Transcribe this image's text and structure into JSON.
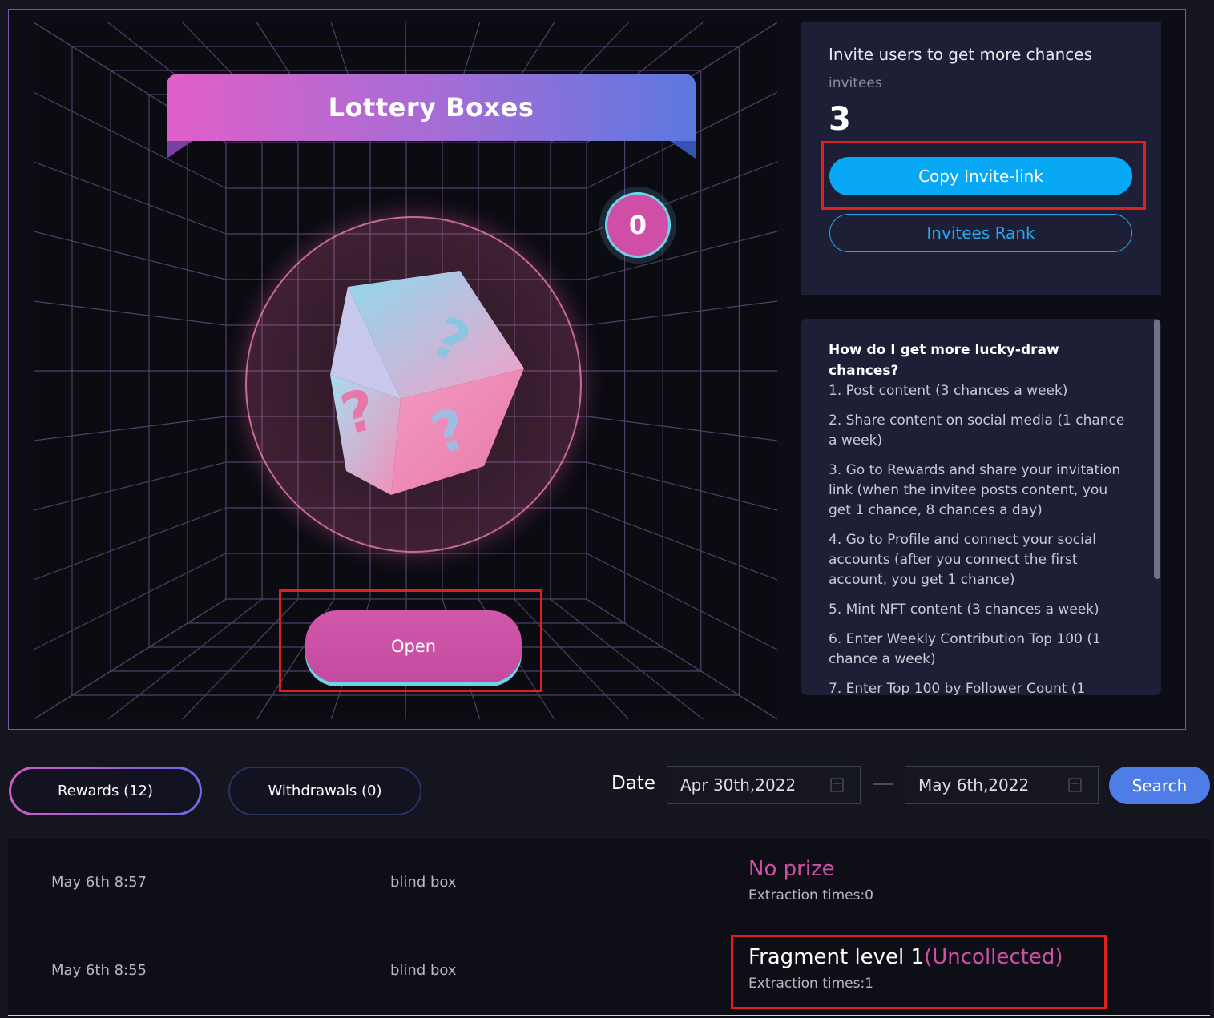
{
  "lottery": {
    "title": "Lottery Boxes",
    "box_count": "0",
    "open_label": "Open"
  },
  "invite": {
    "title": "Invite users to get more chances",
    "invitees_label": "invitees",
    "invitees_count": "3",
    "copy_button": "Copy Invite-link",
    "rank_button": "Invitees Rank"
  },
  "rules": {
    "title": "How do I get more lucky-draw chances?",
    "items": [
      "1. Post content (3 chances a week)",
      "2. Share content on social media (1 chance a week)",
      "3. Go to Rewards and share your invitation link (when the invitee posts content, you get 1 chance, 8 chances a day)",
      "4. Go to Profile and connect your social accounts (after you connect the first account, you get 1 chance)",
      "5. Mint NFT content (3 chances a week)",
      "6. Enter Weekly Contribution Top 100 (1 chance a week)",
      "7. Enter Top 100 by Follower Count (1"
    ]
  },
  "tabs": {
    "rewards": "Rewards (12)",
    "withdrawals": "Withdrawals (0)"
  },
  "filter": {
    "date_label": "Date",
    "date_from": "Apr 30th,2022",
    "date_to": "May 6th,2022",
    "search_label": "Search"
  },
  "records": [
    {
      "time": "May 6th 8:57",
      "type": "blind box",
      "result": "No prize",
      "status": "",
      "extraction": "Extraction times:0"
    },
    {
      "time": "May 6th 8:55",
      "type": "blind box",
      "result": "Fragment level 1",
      "status": "(Uncollected)",
      "extraction": "Extraction times:1"
    }
  ],
  "colors": {
    "accent_pink": "#cf4fa6",
    "accent_blue": "#09a8f4",
    "search_blue": "#4f7de8",
    "highlight_red": "#e0201c"
  }
}
